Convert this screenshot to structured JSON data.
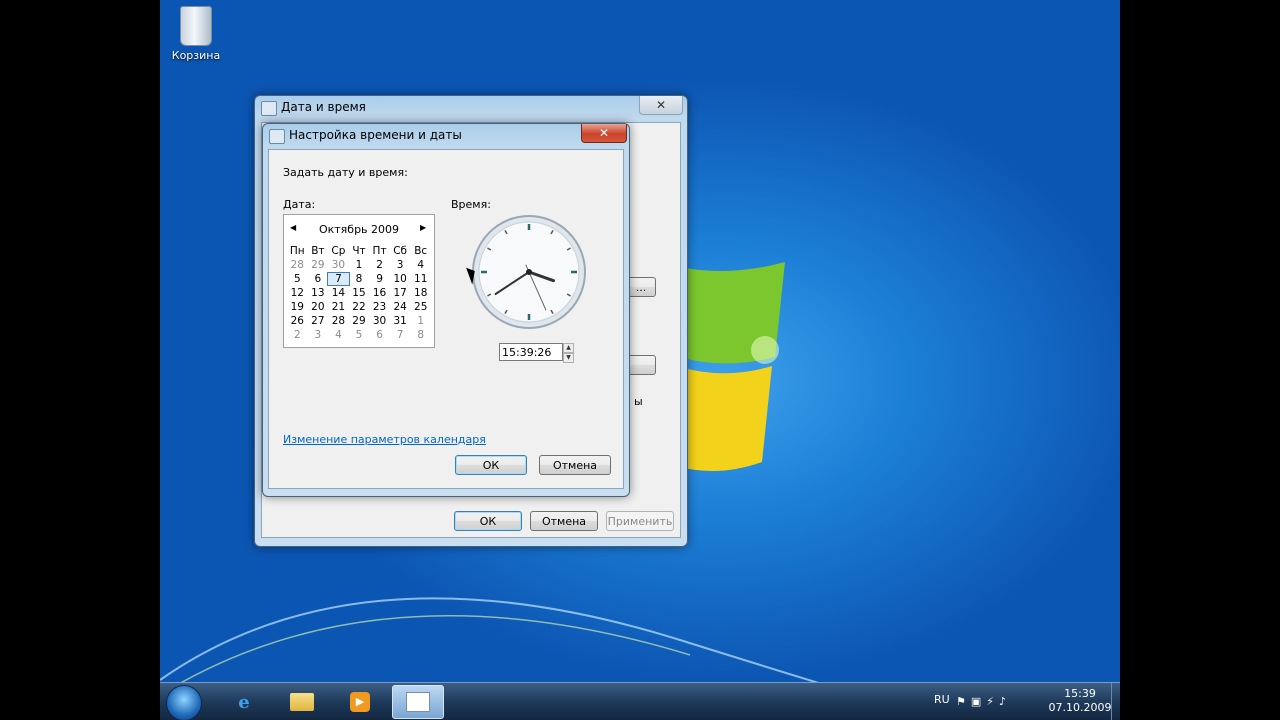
{
  "desktop": {
    "recycle_bin_label": "Корзина"
  },
  "outer_window": {
    "title": "Дата и время",
    "close_symbol": "✕",
    "partial_button_1": "...",
    "partial_text": "ы",
    "ok_label": "ОК",
    "cancel_label": "Отмена",
    "apply_label": "Применить"
  },
  "dialog": {
    "title": "Настройка времени и даты",
    "close_symbol": "✕",
    "instruction": "Задать дату и время:",
    "date_label": "Дата:",
    "time_label": "Время:",
    "calendar": {
      "month_title": "Октябрь 2009",
      "prev_icon": "◀",
      "next_icon": "▶",
      "weekdays": [
        "Пн",
        "Вт",
        "Ср",
        "Чт",
        "Пт",
        "Сб",
        "Вс"
      ],
      "selected_day": "7",
      "days": [
        [
          "28",
          "29",
          "30",
          "1",
          "2",
          "3",
          "4"
        ],
        [
          "5",
          "6",
          "7",
          "8",
          "9",
          "10",
          "11"
        ],
        [
          "12",
          "13",
          "14",
          "15",
          "16",
          "17",
          "18"
        ],
        [
          "19",
          "20",
          "21",
          "22",
          "23",
          "24",
          "25"
        ],
        [
          "26",
          "27",
          "28",
          "29",
          "30",
          "31",
          "1"
        ],
        [
          "2",
          "3",
          "4",
          "5",
          "6",
          "7",
          "8"
        ]
      ],
      "dim_cells": [
        [
          0,
          0
        ],
        [
          0,
          1
        ],
        [
          0,
          2
        ],
        [
          4,
          6
        ],
        [
          5,
          0
        ],
        [
          5,
          1
        ],
        [
          5,
          2
        ],
        [
          5,
          3
        ],
        [
          5,
          4
        ],
        [
          5,
          5
        ],
        [
          5,
          6
        ]
      ]
    },
    "clock": {
      "hours": 15,
      "minutes": 39,
      "seconds": 26
    },
    "time_value": "15:39:26",
    "calendar_settings_link": "Изменение параметров календаря",
    "ok_label": "ОК",
    "cancel_label": "Отмена"
  },
  "taskbar": {
    "language": "RU",
    "time": "15:39",
    "date": "07.10.2009",
    "items": [
      "start-orb",
      "internet-explorer-icon",
      "folder-icon",
      "media-player-icon",
      "date-time-icon"
    ]
  },
  "colors": {
    "desktop_blue": "#1c7fd6",
    "logo_green": "#7cc62e",
    "logo_yellow": "#f2d21a",
    "link_blue": "#0066cc"
  }
}
